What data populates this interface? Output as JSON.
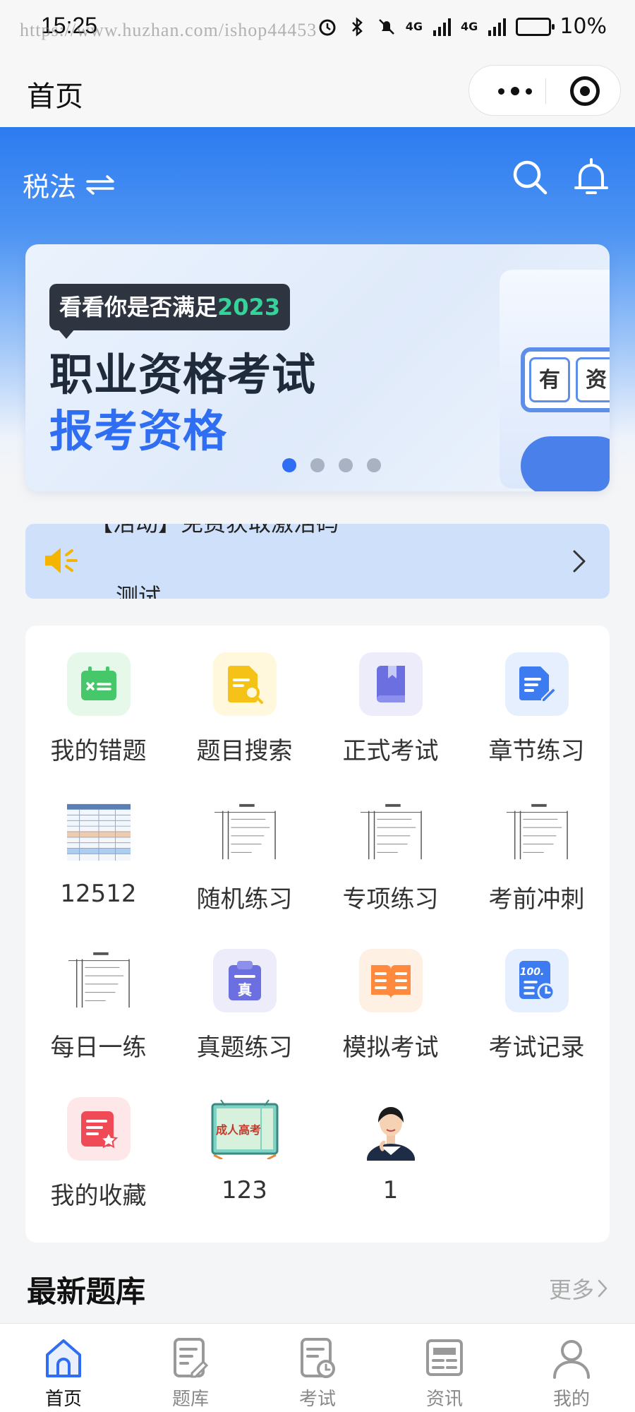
{
  "status_bar": {
    "time": "15:25",
    "watermark": "https://www.huzhan.com/ishop44453",
    "network_1": "4G",
    "network_2": "4G",
    "battery": "10%"
  },
  "miniapp_nav": {
    "title": "首页"
  },
  "header": {
    "subject": "税法",
    "swap_icon": "swap-icon",
    "search_icon": "search-icon",
    "bell_icon": "bell-icon",
    "accent_color": "#2c7bf0"
  },
  "banner": {
    "tag_text": "看看你是否满足",
    "tag_year": "2023",
    "line1": "职业资格考试",
    "line2": "报考资格",
    "deco_chars": [
      "有",
      "资"
    ],
    "slide_count": 4,
    "active_slide": 0
  },
  "notice": {
    "icon": "speaker-icon",
    "line1": "【活动】免费获取激活码",
    "line2": "测试"
  },
  "grid": {
    "items": [
      {
        "label": "我的错题",
        "icon": "wrong-book-icon",
        "color": "#46c769",
        "bg": "#e6f8ea"
      },
      {
        "label": "题目搜索",
        "icon": "search-doc-icon",
        "color": "#f5c318",
        "bg": "#fff8dc"
      },
      {
        "label": "正式考试",
        "icon": "book-icon",
        "color": "#6b6fe0",
        "bg": "#ececfb"
      },
      {
        "label": "章节练习",
        "icon": "edit-doc-icon",
        "color": "#3d7bf0",
        "bg": "#e6effd"
      },
      {
        "label": "12512",
        "icon": "table-thumbnail"
      },
      {
        "label": "随机练习",
        "icon": "document-thumbnail"
      },
      {
        "label": "专项练习",
        "icon": "document-thumbnail"
      },
      {
        "label": "考前冲刺",
        "icon": "document-thumbnail"
      },
      {
        "label": "每日一练",
        "icon": "document-thumbnail"
      },
      {
        "label": "真题练习",
        "icon": "real-exam-icon",
        "color": "#6b6fe0",
        "bg": "#ececfb"
      },
      {
        "label": "模拟考试",
        "icon": "open-book-icon",
        "color": "#ff8a3d",
        "bg": "#fff0e4"
      },
      {
        "label": "考试记录",
        "icon": "score-record-icon",
        "color": "#3d7bf0",
        "bg": "#e6effd"
      },
      {
        "label": "我的收藏",
        "icon": "favorite-icon",
        "color": "#ef4a55",
        "bg": "#fde7e8"
      },
      {
        "label": "123",
        "icon": "adult-exam-image",
        "image_text": "成人高考"
      },
      {
        "label": "1",
        "icon": "person-photo"
      }
    ]
  },
  "latest": {
    "title": "最新题库",
    "more": "更多"
  },
  "tabbar": {
    "items": [
      {
        "label": "首页",
        "icon": "home-icon",
        "active": true
      },
      {
        "label": "题库",
        "icon": "question-bank-icon",
        "active": false
      },
      {
        "label": "考试",
        "icon": "exam-icon",
        "active": false
      },
      {
        "label": "资讯",
        "icon": "news-icon",
        "active": false
      },
      {
        "label": "我的",
        "icon": "profile-icon",
        "active": false
      }
    ]
  }
}
